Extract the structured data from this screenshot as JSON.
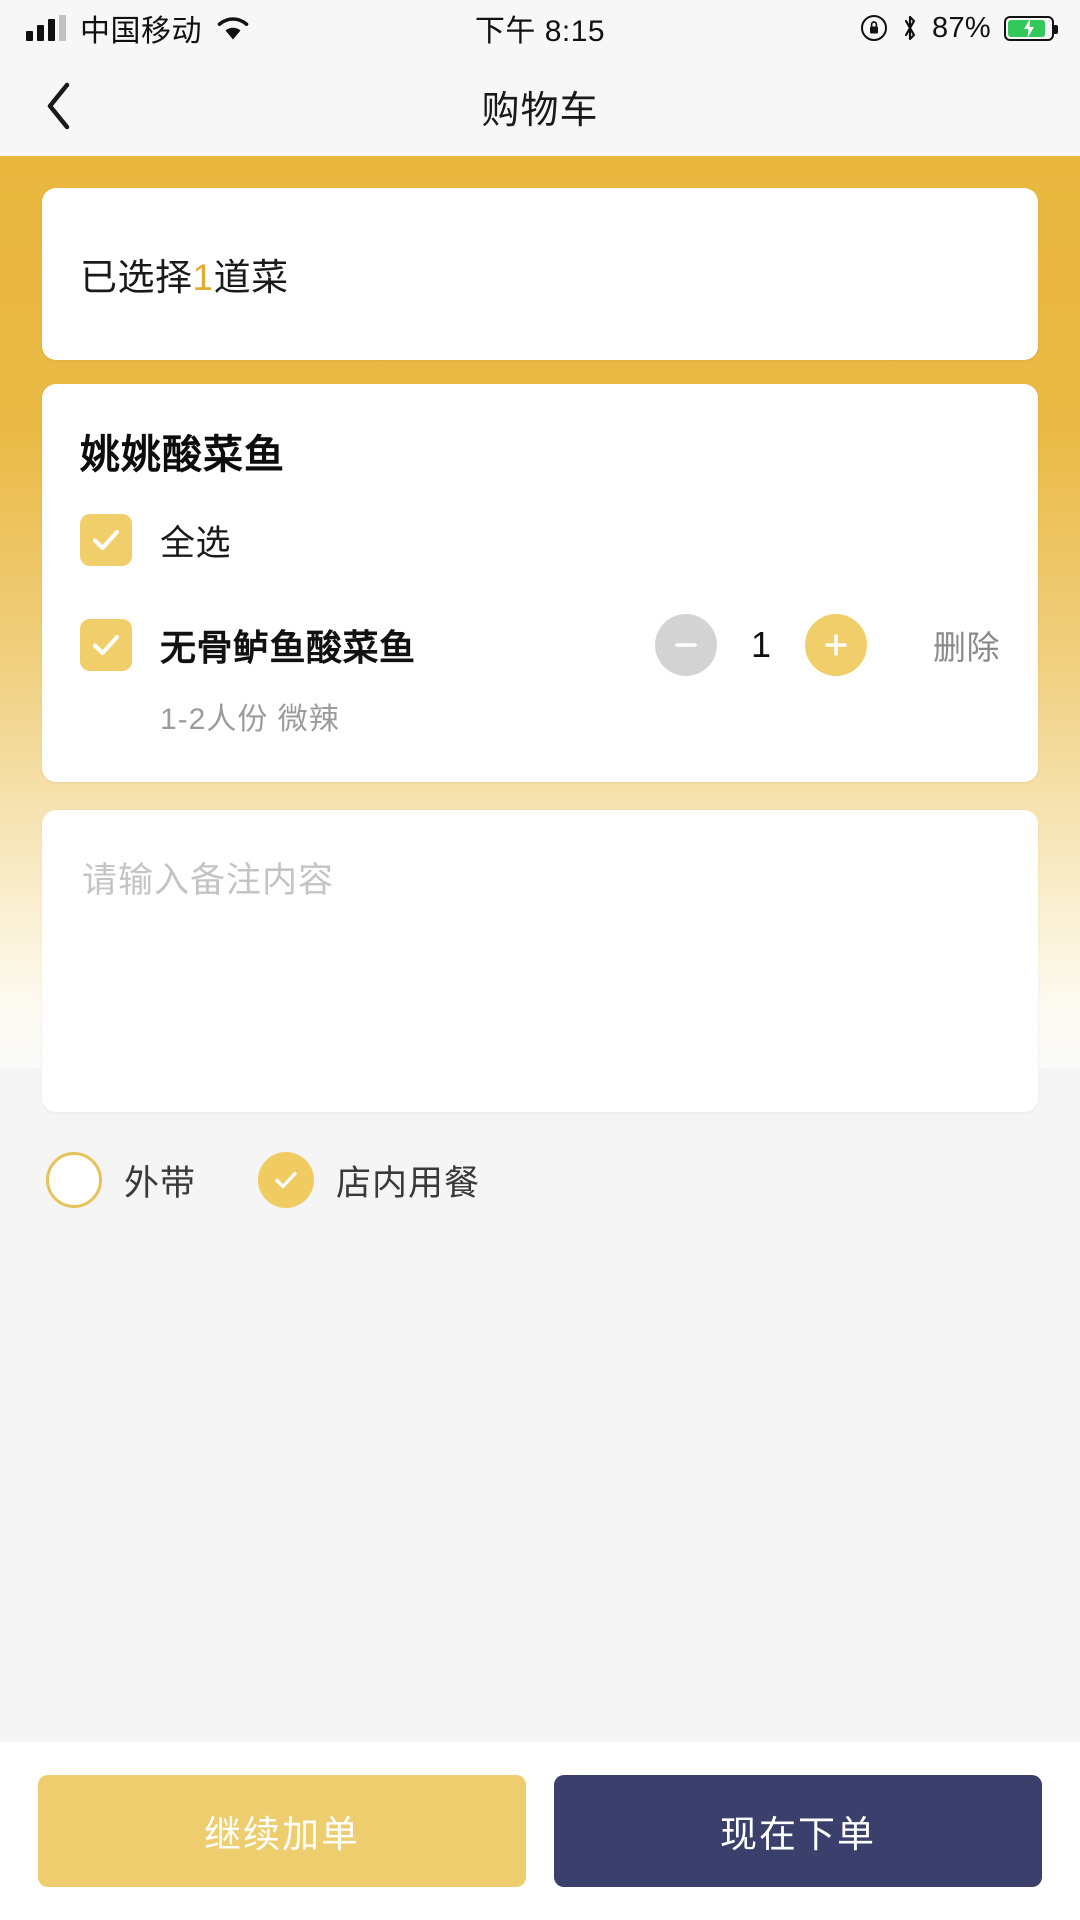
{
  "status_bar": {
    "carrier": "中国移动",
    "time": "下午 8:15",
    "battery_percent": "87%",
    "battery_level": 87,
    "icons": [
      "signal-bars-icon",
      "wifi-icon",
      "rotation-lock-icon",
      "bluetooth-icon",
      "battery-charging-icon"
    ]
  },
  "nav": {
    "title": "购物车",
    "back_icon": "chevron-left-icon"
  },
  "summary": {
    "prefix": "已选择",
    "count": "1",
    "suffix": "道菜"
  },
  "shop": {
    "name": "姚姚酸菜鱼",
    "select_all_label": "全选",
    "select_all_checked": true,
    "items": [
      {
        "name": "无骨鲈鱼酸菜鱼",
        "spec": "1-2人份 微辣",
        "quantity": "1",
        "checked": true,
        "minus_label": "−",
        "plus_label": "+",
        "delete_label": "删除"
      }
    ]
  },
  "notes": {
    "placeholder": "请输入备注内容",
    "value": ""
  },
  "dining_options": [
    {
      "label": "外带",
      "selected": false
    },
    {
      "label": "店内用餐",
      "selected": true
    }
  ],
  "bottom_actions": {
    "secondary_label": "继续加单",
    "primary_label": "现在下单"
  },
  "colors": {
    "gold": "#e9b73e",
    "gold_light": "#f0ce6a",
    "navy": "#3a3f6b",
    "page_bg": "#f5f5f5",
    "muted_text": "#9b9b9b"
  }
}
